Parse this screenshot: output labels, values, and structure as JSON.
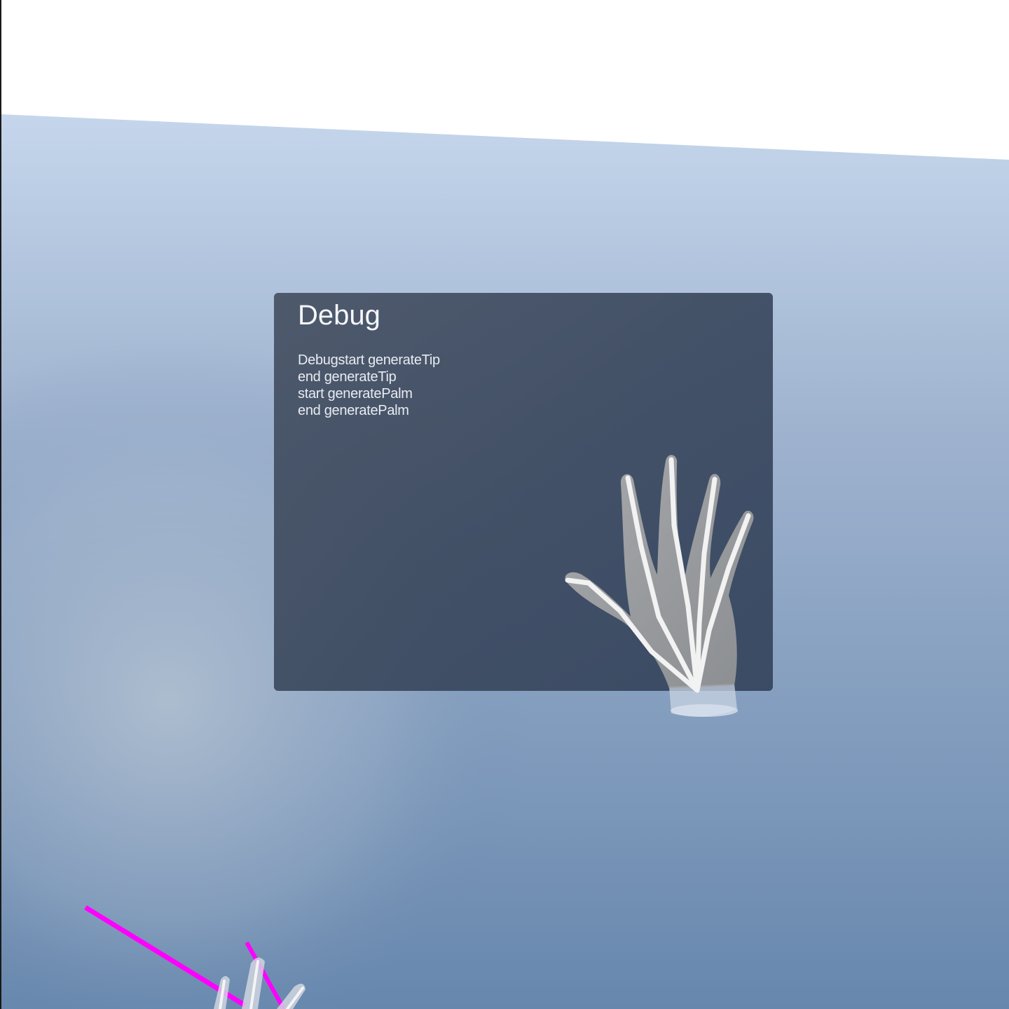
{
  "panel": {
    "title": "Debug",
    "log_lines": [
      "Debugstart generateTip",
      "end generateTip",
      "start generatePalm",
      "end generatePalm"
    ]
  },
  "colors": {
    "sky_top": "#c5d6ec",
    "sky_bottom": "#6787ad",
    "panel_bg": "#3e4a5e",
    "ray": "#ff00ff",
    "hand": "#c8c8c8"
  },
  "icons": {
    "right_hand": "hand-model",
    "left_hand": "hand-model",
    "pointer_ray": "laser-ray"
  }
}
